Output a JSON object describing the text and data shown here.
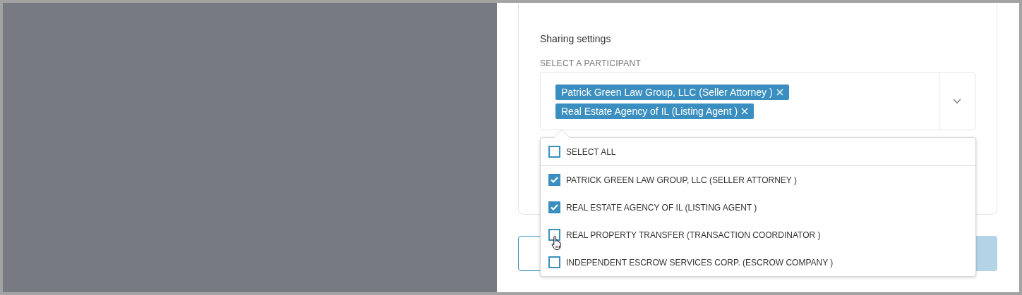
{
  "section_title": "Sharing settings",
  "participant_label": "SELECT A PARTICIPANT",
  "selected_tags": [
    {
      "label": "Patrick Green Law Group, LLC (Seller Attorney )"
    },
    {
      "label": "Real Estate Agency of IL (Listing Agent )"
    }
  ],
  "dropdown": {
    "expanded": true,
    "select_all": {
      "label": "SELECT ALL",
      "checked": false
    },
    "options": [
      {
        "label": "PATRICK GREEN LAW GROUP, LLC (SELLER ATTORNEY )",
        "checked": true
      },
      {
        "label": "REAL ESTATE AGENCY OF IL (LISTING AGENT )",
        "checked": true
      },
      {
        "label": "REAL PROPERTY TRANSFER (TRANSACTION COORDINATOR )",
        "checked": false
      },
      {
        "label": "INDEPENDENT ESCROW SERVICES CORP. (ESCROW COMPANY )",
        "checked": false
      }
    ]
  }
}
